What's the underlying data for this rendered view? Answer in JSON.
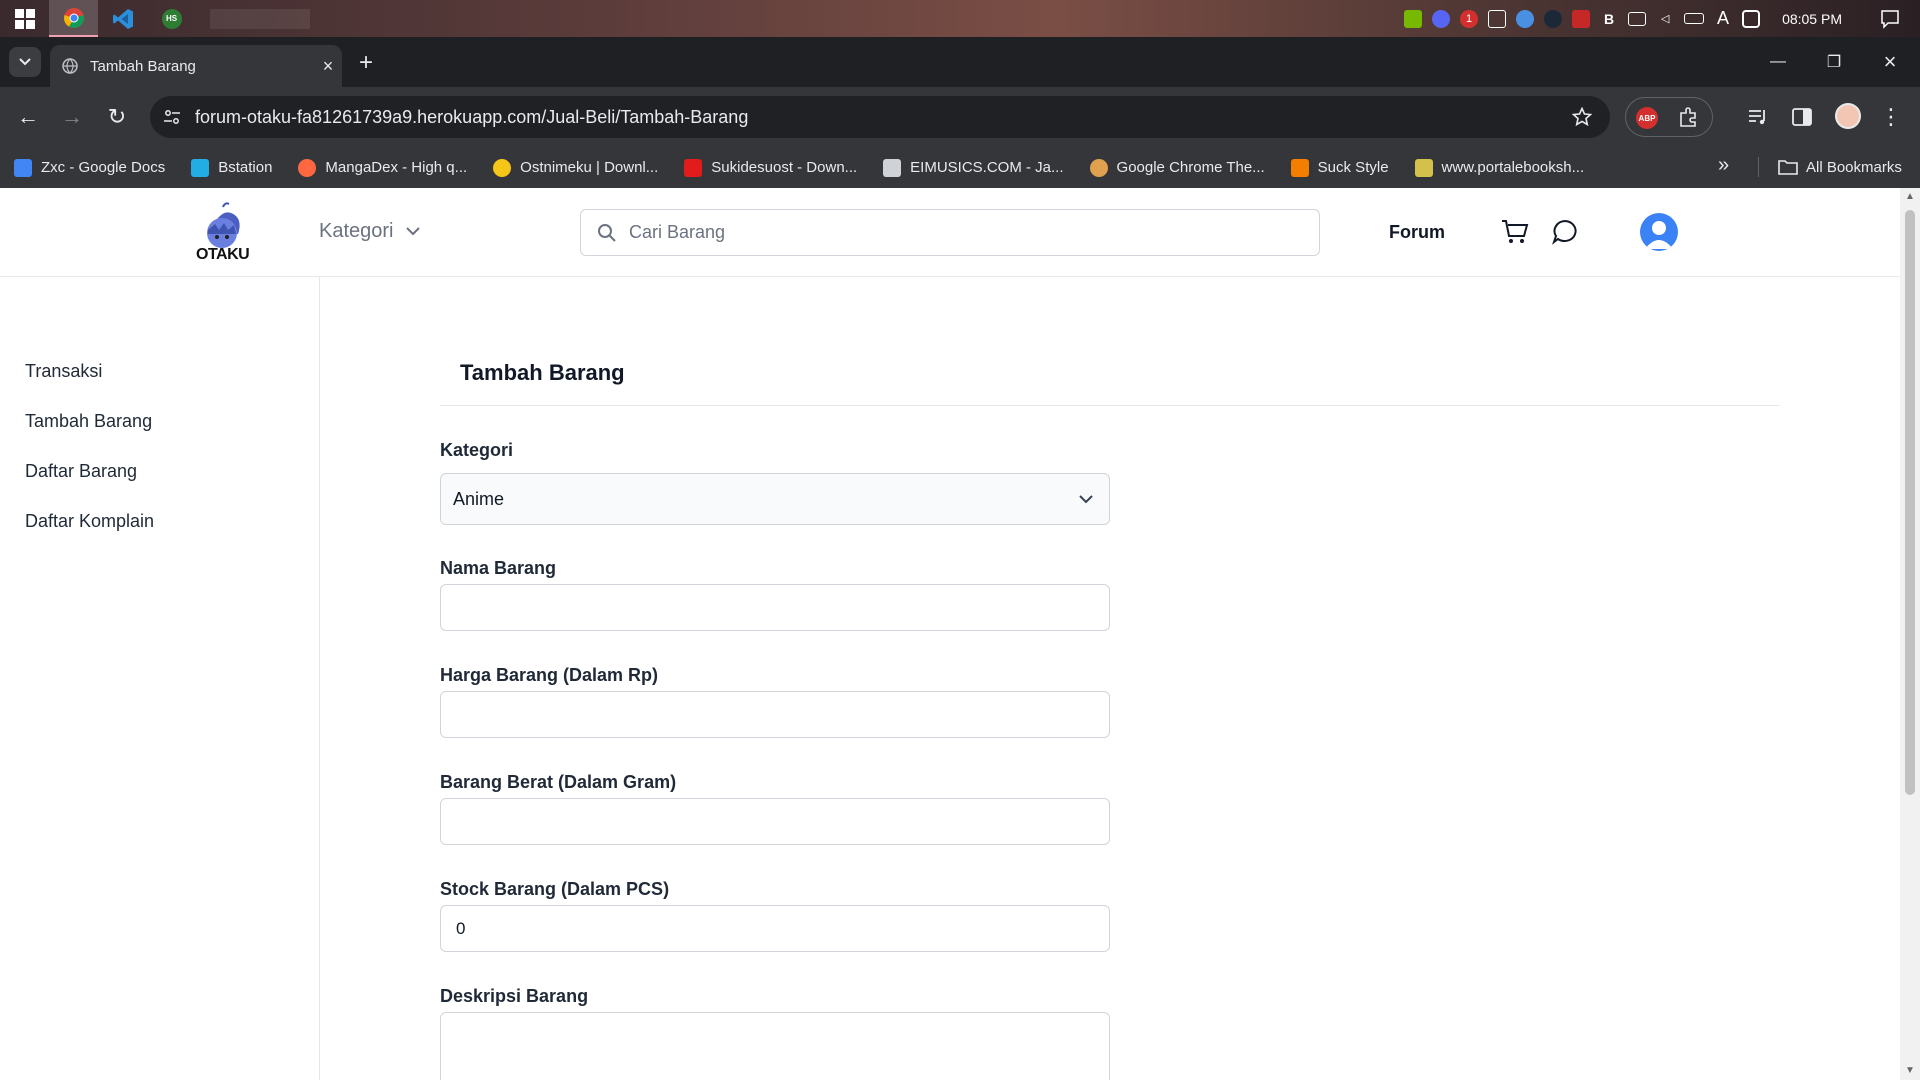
{
  "taskbar": {
    "apps": [
      "windows-start",
      "chrome",
      "vscode",
      "app-hs"
    ],
    "clock": "08:05 PM"
  },
  "browser": {
    "tab_title": "Tambah Barang",
    "url": "forum-otaku-fa81261739a9.herokuapp.com/Jual-Beli/Tambah-Barang",
    "extension_abp": "ABP",
    "bookmarks": [
      {
        "label": "Zxc - Google Docs",
        "color": "#4285f4"
      },
      {
        "label": "Bstation",
        "color": "#23ade5"
      },
      {
        "label": "MangaDex - High q...",
        "color": "#ff6740"
      },
      {
        "label": "Ostnimeku | Downl...",
        "color": "#f5c518"
      },
      {
        "label": "Sukidesuost - Down...",
        "color": "#e21b1b"
      },
      {
        "label": "EIMUSICS.COM - Ja...",
        "color": "#cfd2d6"
      },
      {
        "label": "Google Chrome The...",
        "color": "#e0a050"
      },
      {
        "label": "Suck Style",
        "color": "#f57d00"
      },
      {
        "label": "www.portalebooksh...",
        "color": "#d4c14a"
      }
    ],
    "all_bookmarks": "All Bookmarks"
  },
  "header": {
    "logo_text": "OTAKU",
    "kategori": "Kategori",
    "search_placeholder": "Cari Barang",
    "forum": "Forum"
  },
  "sidebar": {
    "items": [
      "Transaksi",
      "Tambah Barang",
      "Daftar Barang",
      "Daftar Komplain"
    ]
  },
  "form": {
    "title": "Tambah Barang",
    "kategori_label": "Kategori",
    "kategori_value": "Anime",
    "nama_label": "Nama Barang",
    "nama_value": "",
    "harga_label": "Harga Barang (Dalam Rp)",
    "harga_value": "",
    "berat_label": "Barang Berat (Dalam Gram)",
    "berat_value": "",
    "stock_label": "Stock Barang (Dalam PCS)",
    "stock_value": "0",
    "deskripsi_label": "Deskripsi Barang"
  },
  "colors": {
    "accent": "#3b82f6",
    "browser_dark": "#35363a"
  }
}
